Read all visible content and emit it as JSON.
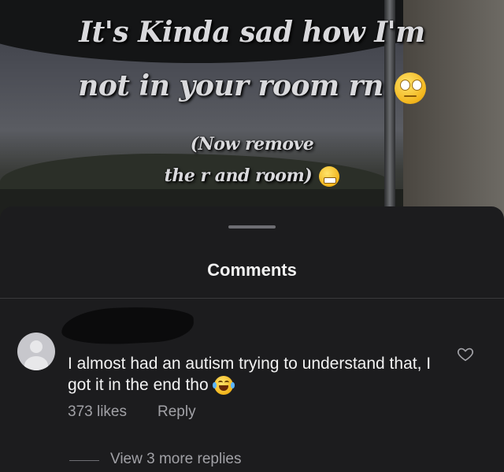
{
  "story": {
    "line1": "It's Kinda sad how I'm",
    "line2": "not in your room rn",
    "line3": "(Now remove",
    "line4": "the r and room)",
    "emoji1": "eye-roll-emoji",
    "emoji2": "grimace-emoji"
  },
  "comments_panel": {
    "title": "Comments"
  },
  "comment": {
    "text": "I almost had an autism trying to understand that, I got it in the end tho",
    "emoji": "tears-of-joy-emoji",
    "likes": "373 likes",
    "reply_label": "Reply",
    "view_replies": "View 3 more replies"
  },
  "colors": {
    "sheet_bg": "#1c1c1e",
    "text_primary": "#f2f2f2",
    "text_secondary": "#a1a1a6"
  }
}
